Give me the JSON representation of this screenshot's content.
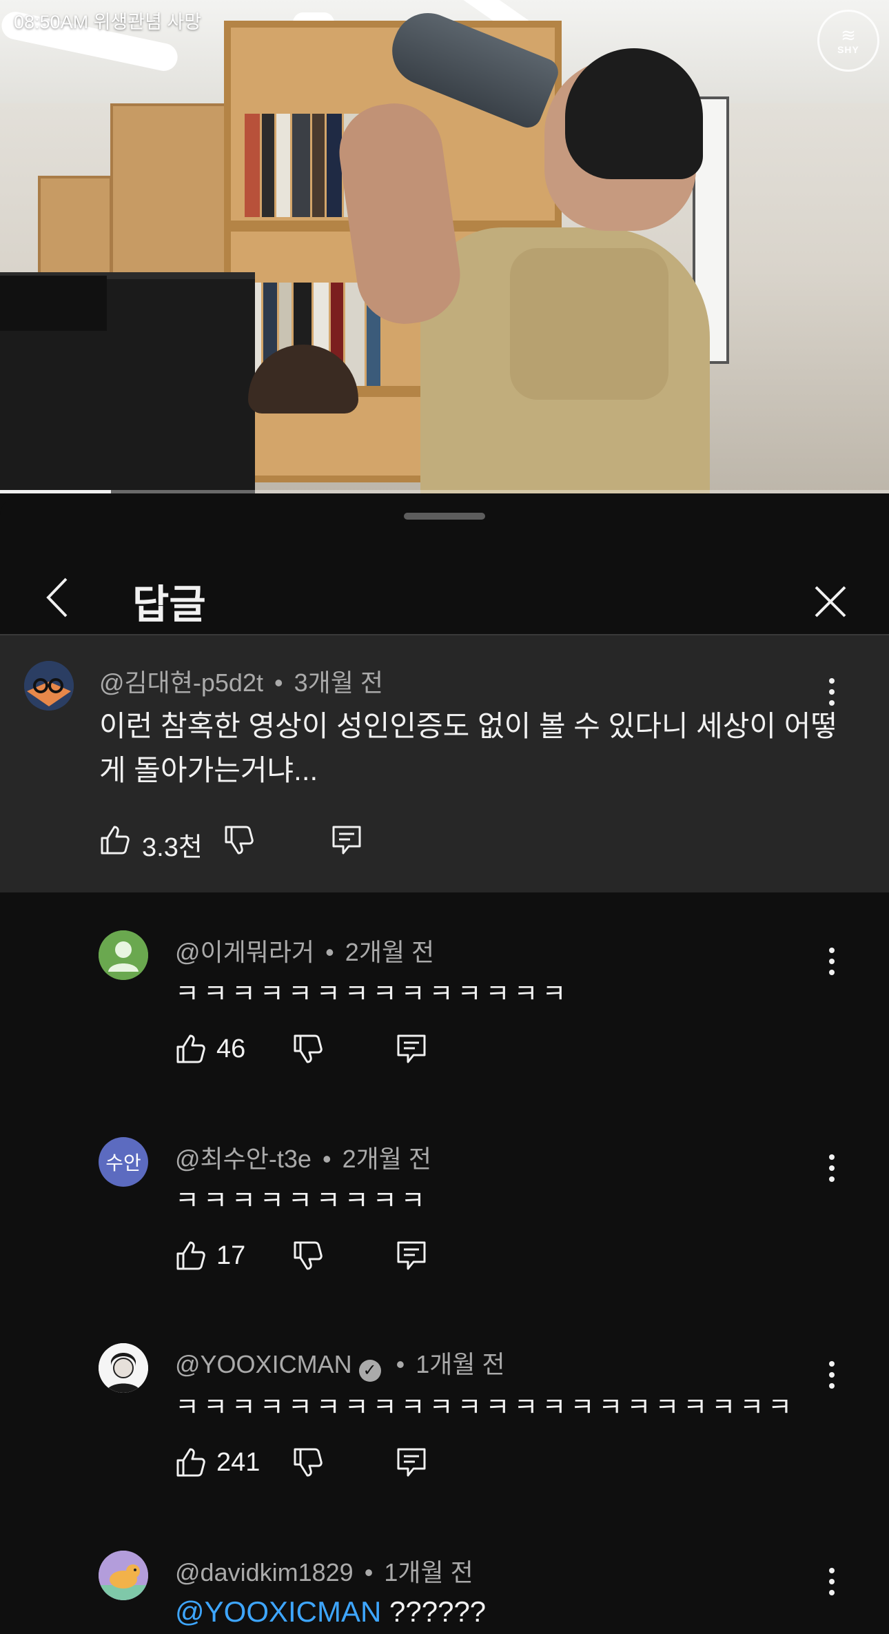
{
  "video": {
    "time_caption": "08:50AM 위생관념 사망",
    "logo_text": "SHY",
    "progress_percent": 12.5
  },
  "sheet": {
    "title": "답글"
  },
  "comments": [
    {
      "handle": "@김대현-p5d2t",
      "time": "3개월 전",
      "text": "이런 참혹한 영상이 성인인증도 없이 볼 수 있다니 세상이 어떻게 돌아가는거냐...",
      "likes": "3.3천",
      "avatar_color": "#e7884a"
    },
    {
      "handle": "@이게뭐라거",
      "time": "2개월 전",
      "text": "ㅋㅋㅋㅋㅋㅋㅋㅋㅋㅋㅋㅋㅋㅋ",
      "likes": "46",
      "avatar_color": "#6aa84f"
    },
    {
      "handle": "@최수안-t3e",
      "time": "2개월 전",
      "text": "ㅋㅋㅋㅋㅋㅋㅋㅋㅋ",
      "likes": "17",
      "avatar_text": "수안",
      "avatar_color": "#5c6bc0"
    },
    {
      "handle": "@YOOXICMAN",
      "time": "1개월 전",
      "text": "ㅋㅋㅋㅋㅋㅋㅋㅋㅋㅋㅋㅋㅋㅋㅋㅋㅋㅋㅋㅋㅋㅋ",
      "likes": "241",
      "avatar_color": "#f5f5f5"
    },
    {
      "handle": "@davidkim1829",
      "time": "1개월 전",
      "mention": "@YOOXICMAN",
      "text": "??????",
      "avatar_color": "#b39ddb"
    }
  ],
  "meta_separator": "•"
}
